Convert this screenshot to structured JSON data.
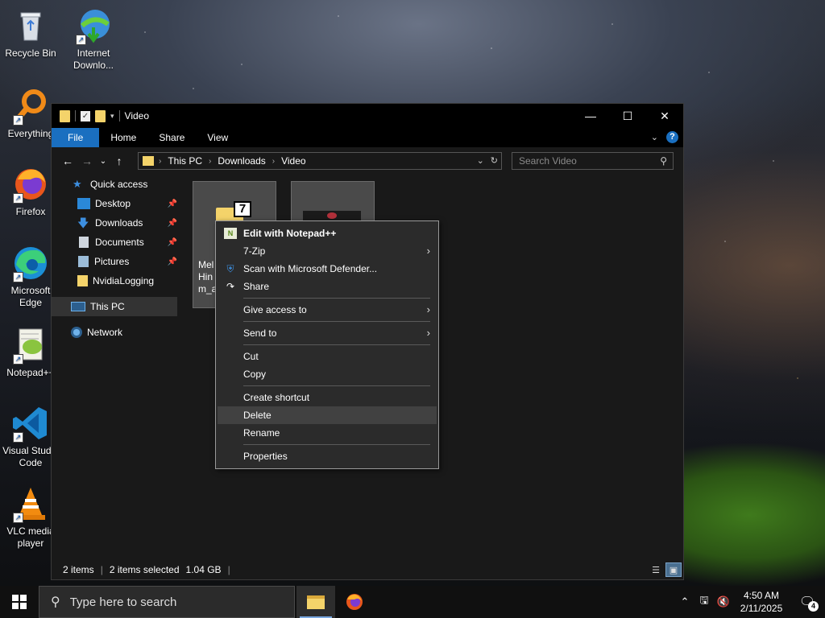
{
  "desktop": {
    "icons": [
      {
        "label": "Recycle Bin",
        "icon": "recycle-bin-icon"
      },
      {
        "label": "Internet Downlo...",
        "icon": "internet-download-manager-icon"
      },
      {
        "label": "Everything",
        "icon": "everything-search-icon"
      },
      {
        "label": "Firefox",
        "icon": "firefox-icon"
      },
      {
        "label": "Microsoft Edge",
        "icon": "edge-icon"
      },
      {
        "label": "Notepad++",
        "icon": "notepadpp-icon"
      },
      {
        "label": "Visual Studio Code",
        "icon": "vscode-icon"
      },
      {
        "label": "VLC media player",
        "icon": "vlc-icon"
      }
    ]
  },
  "explorer": {
    "title": "Video",
    "ribbon_tabs": [
      "File",
      "Home",
      "Share",
      "View"
    ],
    "breadcrumb": [
      "This PC",
      "Downloads",
      "Video"
    ],
    "search_placeholder": "Search Video",
    "nav": {
      "quick_access": "Quick access",
      "pinned": [
        "Desktop",
        "Downloads",
        "Documents",
        "Pictures"
      ],
      "other": "NvidiaLogging",
      "this_pc": "This PC",
      "network": "Network"
    },
    "files": [
      {
        "label": "Mel\nHin\nm_a"
      },
      {
        "label": ""
      }
    ],
    "status": {
      "items": "2 items",
      "selected": "2 items selected",
      "size": "1.04 GB"
    }
  },
  "context_menu": {
    "items": [
      {
        "label": "Edit with Notepad++",
        "icon": "notepadpp-icon",
        "bold": true
      },
      {
        "label": "7-Zip",
        "submenu": true
      },
      {
        "label": "Scan with Microsoft Defender...",
        "icon": "defender-shield-icon"
      },
      {
        "label": "Share",
        "icon": "share-icon"
      },
      {
        "sep": true
      },
      {
        "label": "Give access to",
        "submenu": true
      },
      {
        "sep": true
      },
      {
        "label": "Send to",
        "submenu": true
      },
      {
        "sep": true
      },
      {
        "label": "Cut"
      },
      {
        "label": "Copy"
      },
      {
        "sep": true
      },
      {
        "label": "Create shortcut"
      },
      {
        "label": "Delete",
        "hover": true
      },
      {
        "label": "Rename"
      },
      {
        "sep": true
      },
      {
        "label": "Properties"
      }
    ]
  },
  "taskbar": {
    "search_placeholder": "Type here to search",
    "time": "4:50 AM",
    "date": "2/11/2025",
    "notification_count": "4"
  },
  "colors": {
    "accent": "#1a6fc0",
    "folder": "#f4d36a"
  }
}
